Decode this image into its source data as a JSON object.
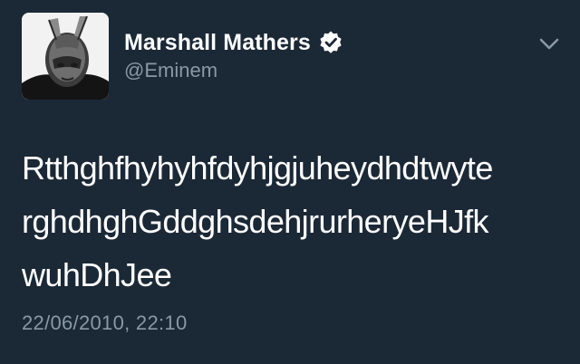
{
  "author": {
    "display_name": "Marshall Mathers",
    "handle": "@Eminem",
    "verified": true,
    "avatar_icon": "profile-photo"
  },
  "tweet": {
    "text_lines": [
      "Rtthghfhyhyhfdyhjgjuheydhdtwyte",
      "rghdhghGddghsdehjrurheryeHJfk",
      "wuhDhJee"
    ],
    "timestamp": "22/06/2010, 22:10"
  },
  "menu": {
    "icon": "chevron-down-icon"
  },
  "colors": {
    "background": "#1b2836",
    "primary_text": "#ffffff",
    "secondary_text": "#8899a6",
    "verified_badge": "#ffffff"
  }
}
